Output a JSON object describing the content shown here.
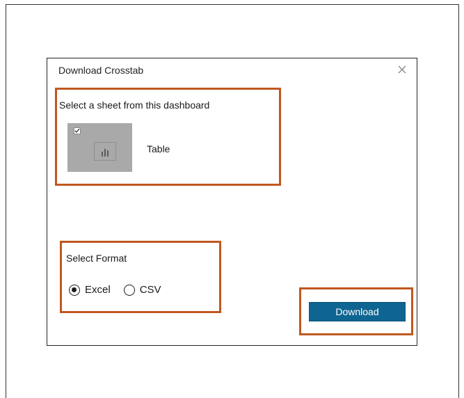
{
  "dialog": {
    "title": "Download Crosstab",
    "close_icon": "close-icon"
  },
  "sheet_section": {
    "label": "Select a sheet from this dashboard",
    "sheets": [
      {
        "name": "Table",
        "checked": true,
        "icon": "bar-chart-icon"
      }
    ]
  },
  "format_section": {
    "label": "Select Format",
    "options": [
      {
        "label": "Excel",
        "selected": true
      },
      {
        "label": "CSV",
        "selected": false
      }
    ]
  },
  "actions": {
    "download_label": "Download"
  },
  "colors": {
    "highlight_border": "#c0581f",
    "primary_button": "#0f6591",
    "thumbnail_bg": "#a9a9a9"
  }
}
